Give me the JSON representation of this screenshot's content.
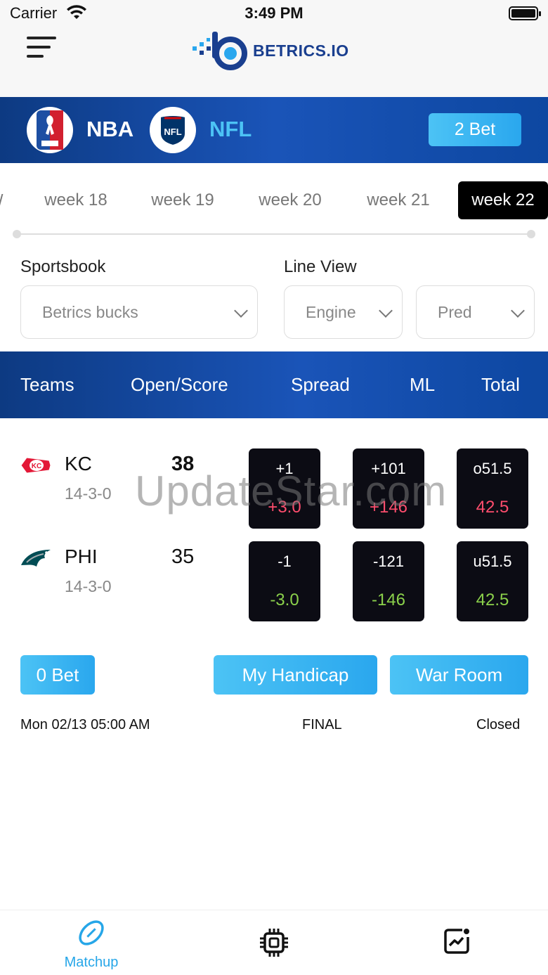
{
  "status_bar": {
    "carrier": "Carrier",
    "time": "3:49 PM"
  },
  "header": {
    "logo_text": "BETRICS.IO",
    "brand_color": "#1a3f8f"
  },
  "leagues": [
    {
      "name": "NBA",
      "active": false
    },
    {
      "name": "NFL",
      "active": true
    }
  ],
  "bet_slip": {
    "label": "2 Bet"
  },
  "weeks": {
    "items": [
      "week 18",
      "week 19",
      "week 20",
      "week 21",
      "week 22"
    ],
    "selected": "week 22"
  },
  "filters": {
    "sportsbook_label": "Sportsbook",
    "sportsbook_value": "Betrics bucks",
    "line_view_label": "Line View",
    "line_view_value": "Engine",
    "mode_value": "Pred"
  },
  "columns": [
    "Teams",
    "Open/Score",
    "Spread",
    "ML",
    "Total"
  ],
  "match": {
    "teams": [
      {
        "abbr": "KC",
        "record": "14-3-0",
        "score": "38",
        "spread": "+1",
        "spread_line": "+3.0",
        "ml": "+101",
        "ml_line": "+146",
        "total": "o51.5",
        "total_line": "42.5"
      },
      {
        "abbr": "PHI",
        "record": "14-3-0",
        "score": "35",
        "spread": "-1",
        "spread_line": "-3.0",
        "ml": "-121",
        "ml_line": "-146",
        "total": "u51.5",
        "total_line": "42.5"
      }
    ],
    "bet_button": "0 Bet",
    "handicap_button": "My Handicap",
    "war_room_button": "War Room",
    "datetime": "Mon 02/13 05:00 AM",
    "status": "FINAL",
    "market": "Closed"
  },
  "watermark": "UpdateStar.com",
  "bottom_nav": {
    "items": [
      {
        "label": "Matchup",
        "icon": "football-icon",
        "active": true
      },
      {
        "label": "",
        "icon": "chip-icon",
        "active": false
      },
      {
        "label": "",
        "icon": "chart-icon",
        "active": false
      }
    ]
  },
  "colors": {
    "accent": "#2aa7ee",
    "header_blue": "#0d3a82",
    "positive": "#8bd14b",
    "negative": "#ff4d6d"
  }
}
